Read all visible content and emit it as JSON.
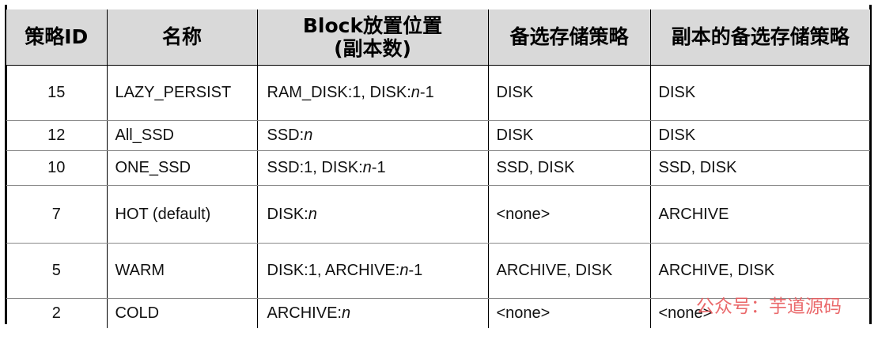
{
  "header": {
    "policy_id": "策略ID",
    "name": "名称",
    "placement_line1": "Block放置位置",
    "placement_line2": "(副本数)",
    "fallback_creation": "备选存储策略",
    "fallback_replication": "副本的备选存储策略"
  },
  "rows": [
    {
      "id": "15",
      "name": "LAZY_PERSIST",
      "placement": [
        {
          "t": "RAM_DISK:1, DISK:"
        },
        {
          "t": "n",
          "i": true
        },
        {
          "t": "-1"
        }
      ],
      "fallback_creation": "DISK",
      "fallback_replication": "DISK"
    },
    {
      "id": "12",
      "name": "All_SSD",
      "placement": [
        {
          "t": "SSD:"
        },
        {
          "t": "n",
          "i": true
        }
      ],
      "fallback_creation": "DISK",
      "fallback_replication": "DISK"
    },
    {
      "id": "10",
      "name": "ONE_SSD",
      "placement": [
        {
          "t": "SSD:1, DISK:"
        },
        {
          "t": "n",
          "i": true
        },
        {
          "t": "-1"
        }
      ],
      "fallback_creation": "SSD, DISK",
      "fallback_replication": "SSD, DISK"
    },
    {
      "id": "7",
      "name": "HOT (default)",
      "placement": [
        {
          "t": "DISK:"
        },
        {
          "t": "n",
          "i": true
        }
      ],
      "fallback_creation": "<none>",
      "fallback_replication": "ARCHIVE"
    },
    {
      "id": "5",
      "name": "WARM",
      "placement": [
        {
          "t": "DISK:1, ARCHIVE:"
        },
        {
          "t": "n",
          "i": true
        },
        {
          "t": "-1"
        }
      ],
      "fallback_creation": "ARCHIVE, DISK",
      "fallback_replication": "ARCHIVE, DISK"
    },
    {
      "id": "2",
      "name": "COLD",
      "placement": [
        {
          "t": "ARCHIVE:"
        },
        {
          "t": "n",
          "i": true
        }
      ],
      "fallback_creation": "<none>",
      "fallback_replication": "<none>"
    }
  ],
  "watermark": "公众号：芋道源码",
  "colors": {
    "header_bg": "#d9d9d9",
    "grid_line": "#000000",
    "row_divider": "#8a8a8a",
    "watermark": "#e8595c"
  }
}
